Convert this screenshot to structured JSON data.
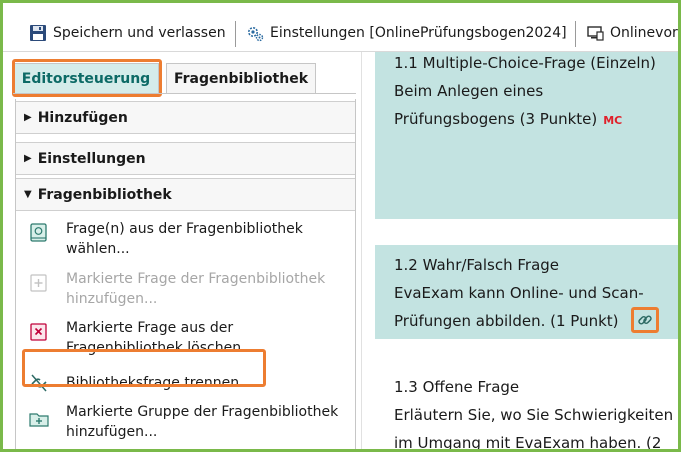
{
  "toolbar": {
    "save_label": "Speichern und verlassen",
    "settings_label": "Einstellungen [OnlinePrüfungsbogen2024]",
    "preview_label": "Onlinevors"
  },
  "tabs": {
    "editor": "Editorsteuerung",
    "library": "Fragenbibliothek"
  },
  "accordion": {
    "add": "Hinzufügen",
    "settings": "Einstellungen",
    "library": "Fragenbibliothek"
  },
  "library_items": [
    {
      "line1": "Frage(n) aus der Fragenbibliothek",
      "line2": "wählen..."
    },
    {
      "line1": "Markierte Frage der Fragenbibliothek",
      "line2": "hinzufügen..."
    },
    {
      "line1": "Markierte Frage aus der",
      "line2": "Fragenbibliothek löschen..."
    },
    {
      "line1": "Bibliotheksfrage trennen..."
    },
    {
      "line1": "Markierte Gruppe der Fragenbibliothek",
      "line2": "hinzufügen..."
    }
  ],
  "questions": [
    {
      "title": "1.1 Multiple-Choice-Frage (Einzeln)",
      "line2": "Beim Anlegen eines",
      "line3": "Prüfungsbogens (3 Punkte)",
      "badge": "MC"
    },
    {
      "title": "1.2 Wahr/Falsch Frage",
      "line2": "EvaExam kann Online- und Scan-",
      "line3": "Prüfungen abbilden. (1 Punkt)"
    },
    {
      "title": "1.3 Offene Frage",
      "line2": "Erläutern Sie, wo Sie Schwierigkeiten",
      "line3": "im Umgang mit EvaExam haben. (2"
    }
  ],
  "colors": {
    "frame_border": "#7ab94a",
    "highlight": "#ed7d31",
    "tab_active_text": "#0d6a66",
    "question_bg": "#c3e3e1",
    "badge": "#e0202a",
    "delete_icon": "#c0003a"
  }
}
